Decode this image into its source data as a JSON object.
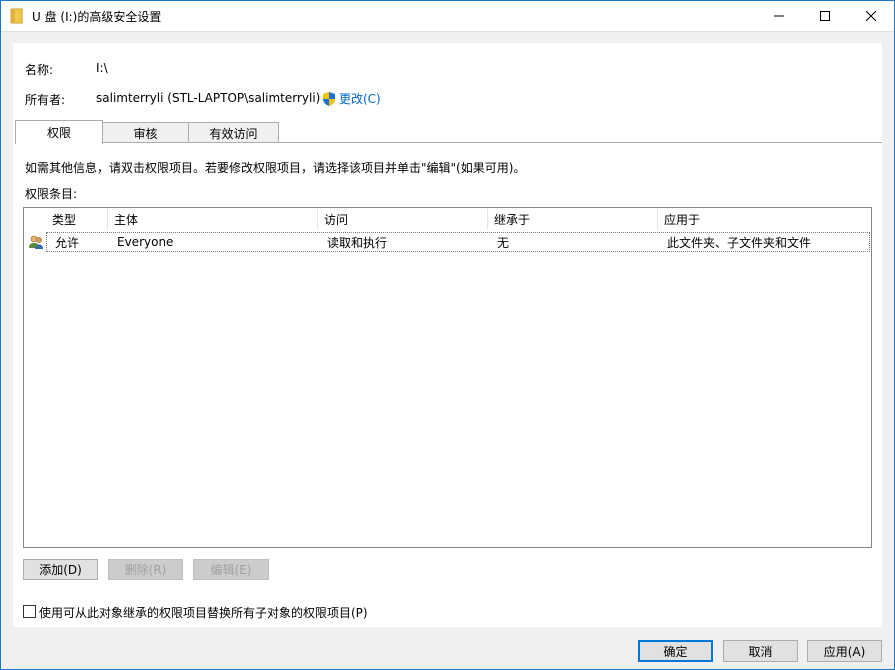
{
  "window": {
    "title": "U 盘 (I:)的高级安全设置"
  },
  "info": {
    "name_label": "名称:",
    "name_value": "I:\\",
    "owner_label": "所有者:",
    "owner_value": "salimterryli (STL-LAPTOP\\salimterryli)",
    "change_link": "更改(C)"
  },
  "tabs": [
    {
      "label": "权限",
      "active": true
    },
    {
      "label": "审核",
      "active": false
    },
    {
      "label": "有效访问",
      "active": false
    }
  ],
  "instructions": "如需其他信息，请双击权限项目。若要修改权限项目，请选择该项目并单击\"编辑\"(如果可用)。",
  "entries_label": "权限条目:",
  "table": {
    "columns": [
      "类型",
      "主体",
      "访问",
      "继承于",
      "应用于"
    ],
    "rows": [
      {
        "type": "允许",
        "principal": "Everyone",
        "access": "读取和执行",
        "inherited": "无",
        "applies": "此文件夹、子文件夹和文件"
      }
    ]
  },
  "buttons": {
    "add": "添加(D)",
    "remove": "删除(R)",
    "edit": "编辑(E)",
    "ok": "确定",
    "cancel": "取消",
    "apply": "应用(A)"
  },
  "replace_checkbox": {
    "label": "使用可从此对象继承的权限项目替换所有子对象的权限项目(P)",
    "checked": false
  },
  "colors": {
    "accent": "#0078d7",
    "link": "#0066cc"
  },
  "icons": [
    "folder-icon",
    "minimize-icon",
    "maximize-icon",
    "close-icon",
    "uac-shield-icon",
    "users-icon"
  ]
}
